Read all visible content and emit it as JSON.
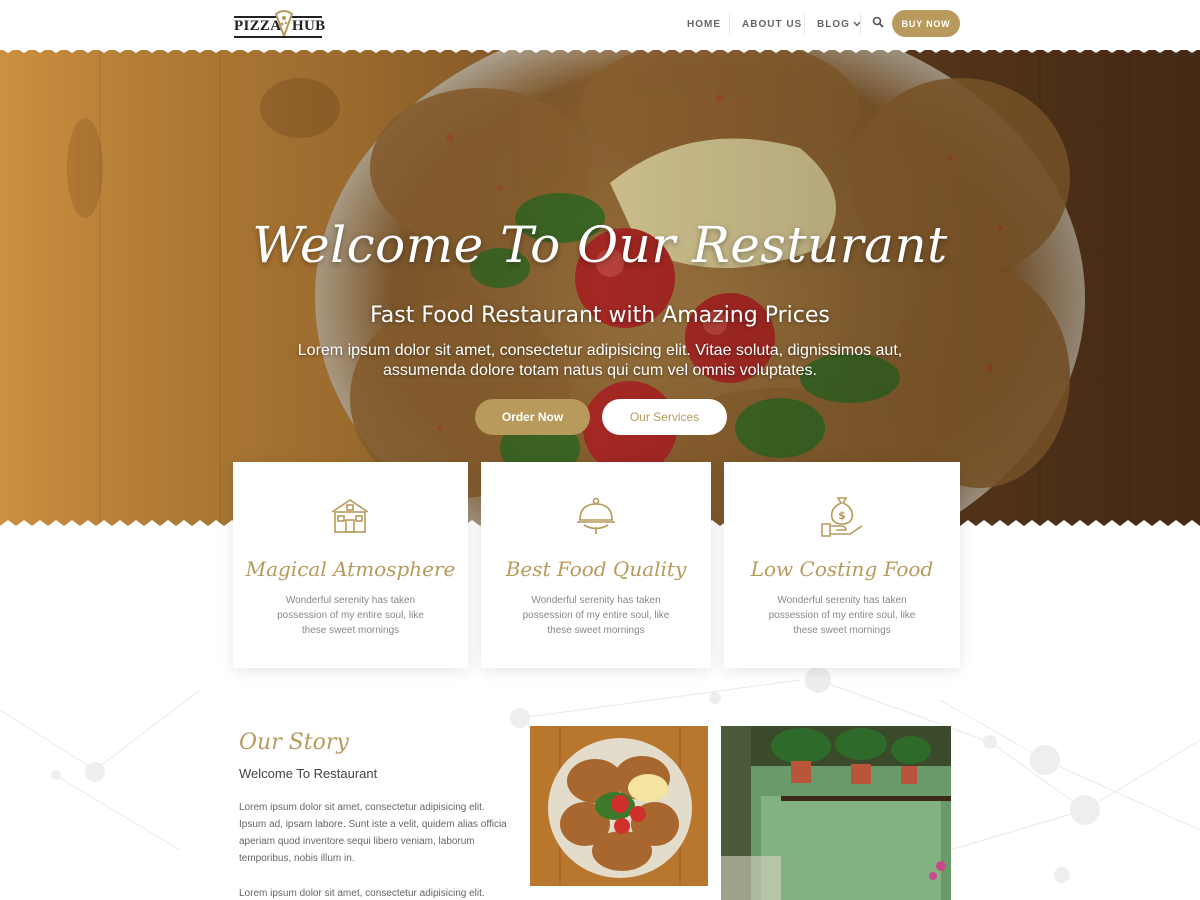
{
  "brand": {
    "logo_left": "PIZZA",
    "logo_right": "HUB"
  },
  "nav": {
    "home": "HOME",
    "about": "ABOUT US",
    "blog": "BLOG",
    "buy_now": "BUY NOW"
  },
  "hero": {
    "title": "Welcome To Our Resturant",
    "subtitle": "Fast Food Restaurant with Amazing Prices",
    "description": "Lorem ipsum dolor sit amet, consectetur adipisicing elit. Vitae soluta, dignissimos aut, assumenda dolore totam natus qui cum vel omnis voluptates.",
    "order_button": "Order Now",
    "services_button": "Our Services"
  },
  "features": [
    {
      "icon": "house-icon",
      "title": "Magical Atmosphere",
      "text": "Wonderful serenity has taken possession of my entire soul, like these sweet mornings"
    },
    {
      "icon": "cloche-icon",
      "title": "Best Food Quality",
      "text": "Wonderful serenity has taken possession of my entire soul, like these sweet mornings"
    },
    {
      "icon": "money-hand-icon",
      "title": "Low Costing Food",
      "text": "Wonderful serenity has taken possession of my entire soul, like these sweet mornings"
    }
  ],
  "story": {
    "title": "Our Story",
    "subtitle": "Welcome To Restaurant",
    "paragraph1": "Lorem ipsum dolor sit amet, consectetur adipisicing elit. Ipsum ad, ipsam labore. Sunt iste a velit, quidem alias officia aperiam quod inventore sequi libero veniam, laborum temporibus, nobis illum in.",
    "paragraph2": "Lorem ipsum dolor sit amet, consectetur adipisicing elit."
  },
  "colors": {
    "accent": "#b79a5c",
    "text": "#333333",
    "muted": "#888888"
  }
}
